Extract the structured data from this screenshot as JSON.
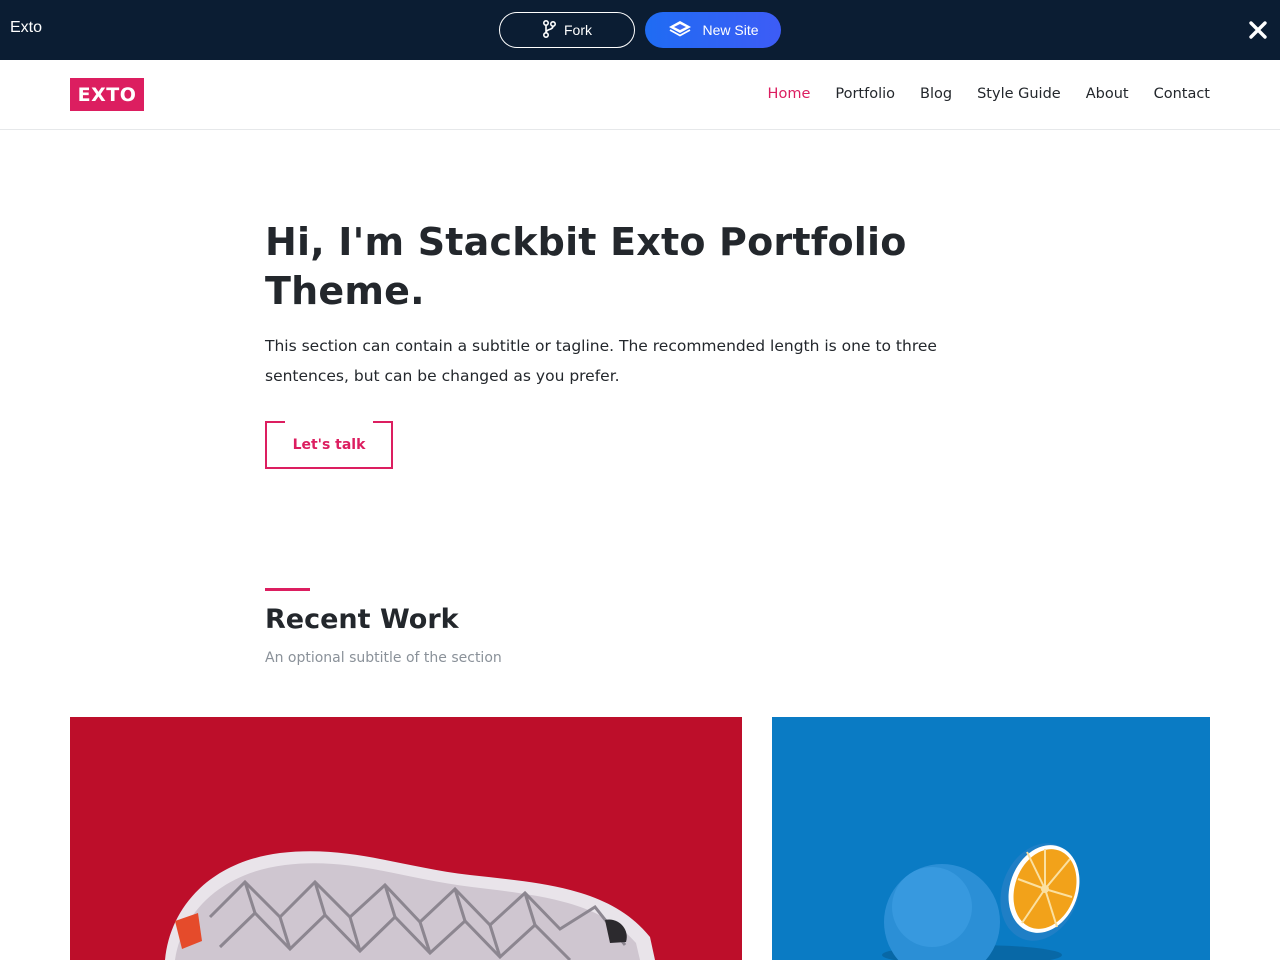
{
  "topbar": {
    "title": "Exto",
    "fork_label": "Fork",
    "new_site_label": "New Site",
    "icons": {
      "fork": "git-fork-icon",
      "new_site": "layers-icon",
      "close": "close-icon"
    }
  },
  "header": {
    "logo": "EXTO",
    "nav": [
      {
        "label": "Home",
        "active": true
      },
      {
        "label": "Portfolio",
        "active": false
      },
      {
        "label": "Blog",
        "active": false
      },
      {
        "label": "Style Guide",
        "active": false
      },
      {
        "label": "About",
        "active": false
      },
      {
        "label": "Contact",
        "active": false
      }
    ]
  },
  "hero": {
    "title": "Hi, I'm Stackbit Exto Portfolio Theme.",
    "subtitle": "This section can contain a subtitle or tagline. The recommended length is one to three sentences, but can be changed as you prefer.",
    "cta_label": "Let's talk"
  },
  "recent_work": {
    "title": "Recent Work",
    "subtitle": "An optional subtitle of the section",
    "items": [
      {
        "image": "red-sneaker-sole-image"
      },
      {
        "image": "blue-orange-fruit-image"
      }
    ]
  },
  "colors": {
    "accent": "#dc1e60",
    "topbar_bg": "#0b1d33",
    "new_site_button": "#2f63f5",
    "text": "#23272c",
    "muted": "#8a9199",
    "work_left_bg": "#bd0e2a",
    "work_right_bg": "#0a7bc4"
  }
}
